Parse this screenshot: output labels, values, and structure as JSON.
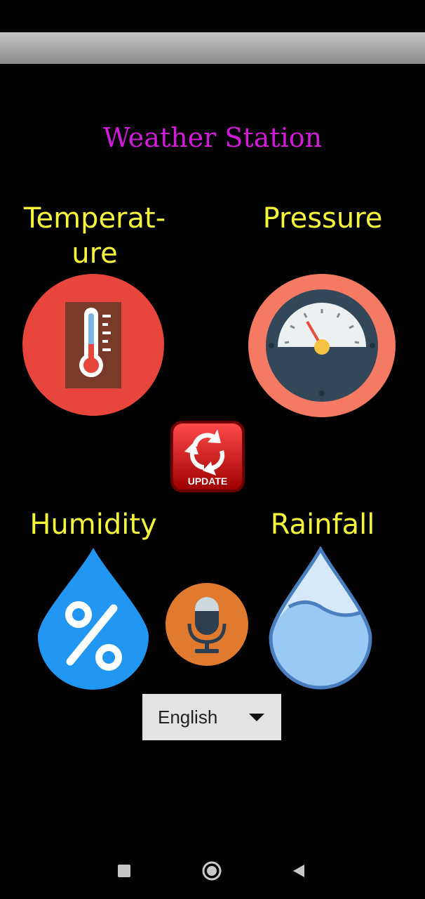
{
  "app": {
    "title": "Weather Station"
  },
  "sensors": {
    "temperature": {
      "label": "Temperat-\nure",
      "icon": "thermometer-icon"
    },
    "pressure": {
      "label": "Pressure",
      "icon": "pressure-gauge-icon"
    },
    "humidity": {
      "label": "Humidity",
      "icon": "humidity-drop-icon"
    },
    "rainfall": {
      "label": "Rainfall",
      "icon": "rain-drop-icon"
    }
  },
  "update_button": {
    "label": "UPDATE",
    "icon": "refresh-icon"
  },
  "voice_button": {
    "icon": "microphone-icon"
  },
  "language": {
    "selected": "English"
  },
  "colors": {
    "title": "#d21ad8",
    "labels": "#f5f53a",
    "background": "#000000"
  },
  "navbar": {
    "icons": [
      "square-recents-icon",
      "circle-home-icon",
      "triangle-back-icon"
    ]
  }
}
